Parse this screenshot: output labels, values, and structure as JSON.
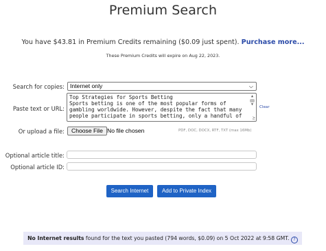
{
  "page": {
    "title": "Premium Search"
  },
  "credits": {
    "prefix": "You have $43.81 in Premium Credits remaining ($0.09 just spent). ",
    "purchase_link": "Purchase more...",
    "expire_note": "These Premium Credits will expire on Aug 22, 2023."
  },
  "form": {
    "search_label": "Search for copies:",
    "search_selected": "Internet only",
    "paste_label": "Paste text or URL:",
    "paste_value_lines": [
      "Top Strategies for Sports Betting",
      "Sports betting is one of the most popular forms of",
      "gambling worldwide. However, despite the fact that many",
      "people participate in sports betting, only a handful of"
    ],
    "clear_link": "Clear",
    "upload_label": "Or upload a file:",
    "choose_file_button": "Choose File",
    "no_file_text": "No file chosen",
    "formats_note": "PDF, DOC, DOCX, RTF, TXT (max 16Mb)",
    "title_label": "Optional article title:",
    "title_value": "",
    "id_label": "Optional article ID:",
    "id_value": ""
  },
  "buttons": {
    "search_internet": "Search Internet",
    "add_private": "Add to Private Index"
  },
  "status": {
    "bold": "No Internet results",
    "rest": " found for the text you pasted (794 words, $0.09) on 5 Oct 2022 at 9:58 GMT. ",
    "help_glyph": "?"
  },
  "colors": {
    "button_blue": "#1f63c5",
    "link_blue": "#2a4aa8",
    "status_bg": "#e8e8f8"
  }
}
